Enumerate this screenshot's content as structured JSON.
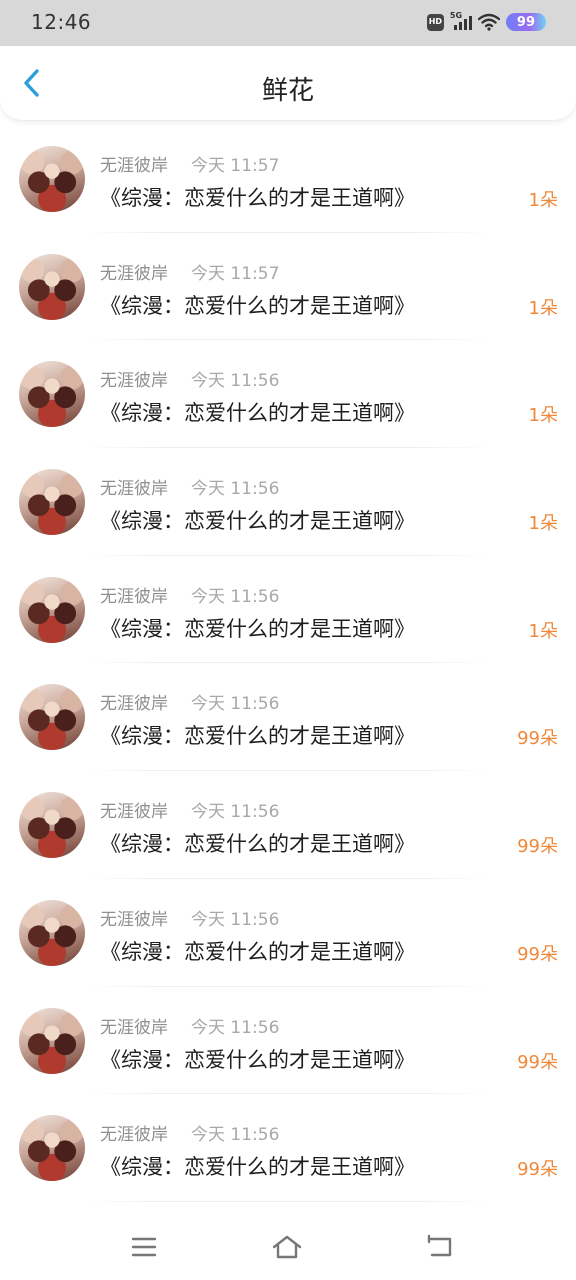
{
  "status_bar": {
    "time": "12:46",
    "hd": "HD",
    "network": "5G",
    "battery": "99"
  },
  "header": {
    "title": "鲜花"
  },
  "items": [
    {
      "user": "无涯彼岸",
      "time": "今天 11:57",
      "title": "《综漫：恋爱什么的才是王道啊》",
      "count": "1朵"
    },
    {
      "user": "无涯彼岸",
      "time": "今天 11:57",
      "title": "《综漫：恋爱什么的才是王道啊》",
      "count": "1朵"
    },
    {
      "user": "无涯彼岸",
      "time": "今天 11:56",
      "title": "《综漫：恋爱什么的才是王道啊》",
      "count": "1朵"
    },
    {
      "user": "无涯彼岸",
      "time": "今天 11:56",
      "title": "《综漫：恋爱什么的才是王道啊》",
      "count": "1朵"
    },
    {
      "user": "无涯彼岸",
      "time": "今天 11:56",
      "title": "《综漫：恋爱什么的才是王道啊》",
      "count": "1朵"
    },
    {
      "user": "无涯彼岸",
      "time": "今天 11:56",
      "title": "《综漫：恋爱什么的才是王道啊》",
      "count": "99朵"
    },
    {
      "user": "无涯彼岸",
      "time": "今天 11:56",
      "title": "《综漫：恋爱什么的才是王道啊》",
      "count": "99朵"
    },
    {
      "user": "无涯彼岸",
      "time": "今天 11:56",
      "title": "《综漫：恋爱什么的才是王道啊》",
      "count": "99朵"
    },
    {
      "user": "无涯彼岸",
      "time": "今天 11:56",
      "title": "《综漫：恋爱什么的才是王道啊》",
      "count": "99朵"
    },
    {
      "user": "无涯彼岸",
      "time": "今天 11:56",
      "title": "《综漫：恋爱什么的才是王道啊》",
      "count": "99朵"
    }
  ],
  "colors": {
    "accent": "#2a9fd8",
    "count": "#f0883a"
  }
}
